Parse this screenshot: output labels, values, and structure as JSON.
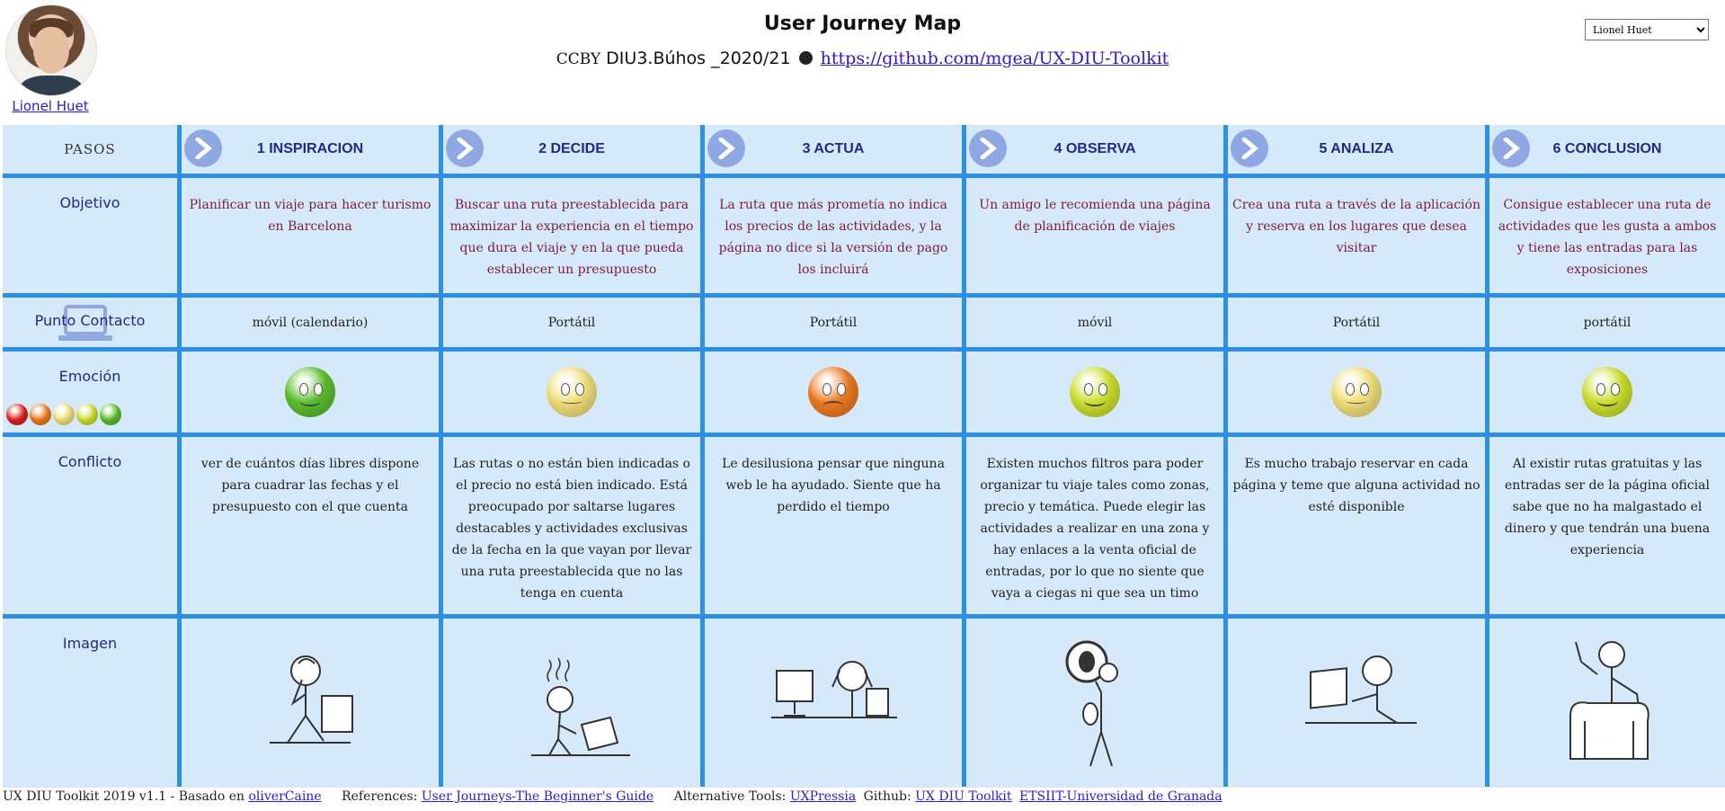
{
  "header": {
    "title": "User Journey Map",
    "license": "CCBY",
    "project": "DIU3.Búhos _2020/21",
    "repo_link": "https://github.com/mgea/UX-DIU-Toolkit"
  },
  "persona": {
    "name": "Lionel Huet",
    "selected": "Lionel Huet"
  },
  "rows": {
    "pasos": "PASOS",
    "objetivo": "Objetivo",
    "contacto": "Punto Contacto",
    "emocion": "Emoción",
    "conflicto": "Conflicto",
    "imagen": "Imagen"
  },
  "steps": [
    {
      "title": "1 INSPIRACION",
      "objetivo": "Planificar un viaje para hacer turismo en Barcelona",
      "contacto": "móvil (calendario)",
      "emotion_color": "#5bc02e",
      "emotion_icon": "happy-face-icon",
      "conflicto": "ver de cuántos días libres dispone para cuadrar las fechas y el presupuesto con el que cuenta",
      "image_icon": "thinking-person-icon"
    },
    {
      "title": "2 DECIDE",
      "objetivo": "Buscar una ruta preestablecida para maximizar la experiencia en el tiempo que dura el viaje y en la que pueda establecer un presupuesto",
      "contacto": "Portátil",
      "emotion_color": "#f2e07a",
      "emotion_icon": "neutral-face-icon",
      "conflicto": "Las rutas o no están bien indicadas o el precio no está bien indicado. Está preocupado por saltarse lugares destacables y actividades exclusivas de la fecha en la que vayan por llevar una ruta preestablecida que no las tenga en cuenta",
      "image_icon": "stressed-laptop-person-icon"
    },
    {
      "title": "3 ACTUA",
      "objetivo": "La ruta que más prometía no indica los precios de las actividades, y la página no dice si la versión de pago los incluirá",
      "contacto": "Portátil",
      "emotion_color": "#ef7b22",
      "emotion_icon": "annoyed-face-icon",
      "conflicto": "Le desilusiona pensar que ninguna web le ha ayudado. Siente que ha perdido el tiempo",
      "image_icon": "frustrated-desk-person-icon"
    },
    {
      "title": "4 OBSERVA",
      "objetivo": "Un amigo le recomienda una página de planificación de viajes",
      "contacto": "móvil",
      "emotion_color": "#cde02e",
      "emotion_icon": "content-face-icon",
      "conflicto": "Existen muchos filtros para poder organizar tu viaje tales como zonas, precio y temática. Puede elegir las actividades a realizar en una zona y hay enlaces a la venta oficial de entradas, por lo que no siente que vaya a ciegas ni que sea un timo",
      "image_icon": "magnifier-person-icon"
    },
    {
      "title": "5 ANALIZA",
      "objetivo": "Crea una ruta a través de la aplicación y reserva en los lugares que desea visitar",
      "contacto": "Portátil",
      "emotion_color": "#f2e07a",
      "emotion_icon": "neutral-face-icon",
      "conflicto": "Es mucho trabajo reservar en cada página y teme que alguna actividad no esté disponible",
      "image_icon": "laptop-person-icon"
    },
    {
      "title": "6 CONCLUSION",
      "objetivo": "Consigue establecer una ruta de actividades que les gusta a ambos y tiene las entradas para las exposiciones",
      "contacto": "portátil",
      "emotion_color": "#cde02e",
      "emotion_icon": "content-face-icon",
      "conflicto": "Al existir rutas gratuitas y las entradas ser de la página oficial sabe que no ha malgastado el dinero y que tendrán una buena experiencia",
      "image_icon": "celebrating-person-icon"
    }
  ],
  "emotion_scale": [
    "#e02020",
    "#ef7b22",
    "#f2e07a",
    "#cde02e",
    "#5bc02e"
  ],
  "footer": {
    "credit": "UX DIU Toolkit 2019 v1.1 - Basado en",
    "credit_link": "oliverCaine",
    "references_label": "References:",
    "references_link": "User Journeys-The Beginner's Guide",
    "alt_label": "Alternative Tools:",
    "alt_link": "UXPressia",
    "github_label": "Github:",
    "github_link": "UX DIU Toolkit",
    "uni_link": "ETSIIT-Universidad de Granada"
  }
}
